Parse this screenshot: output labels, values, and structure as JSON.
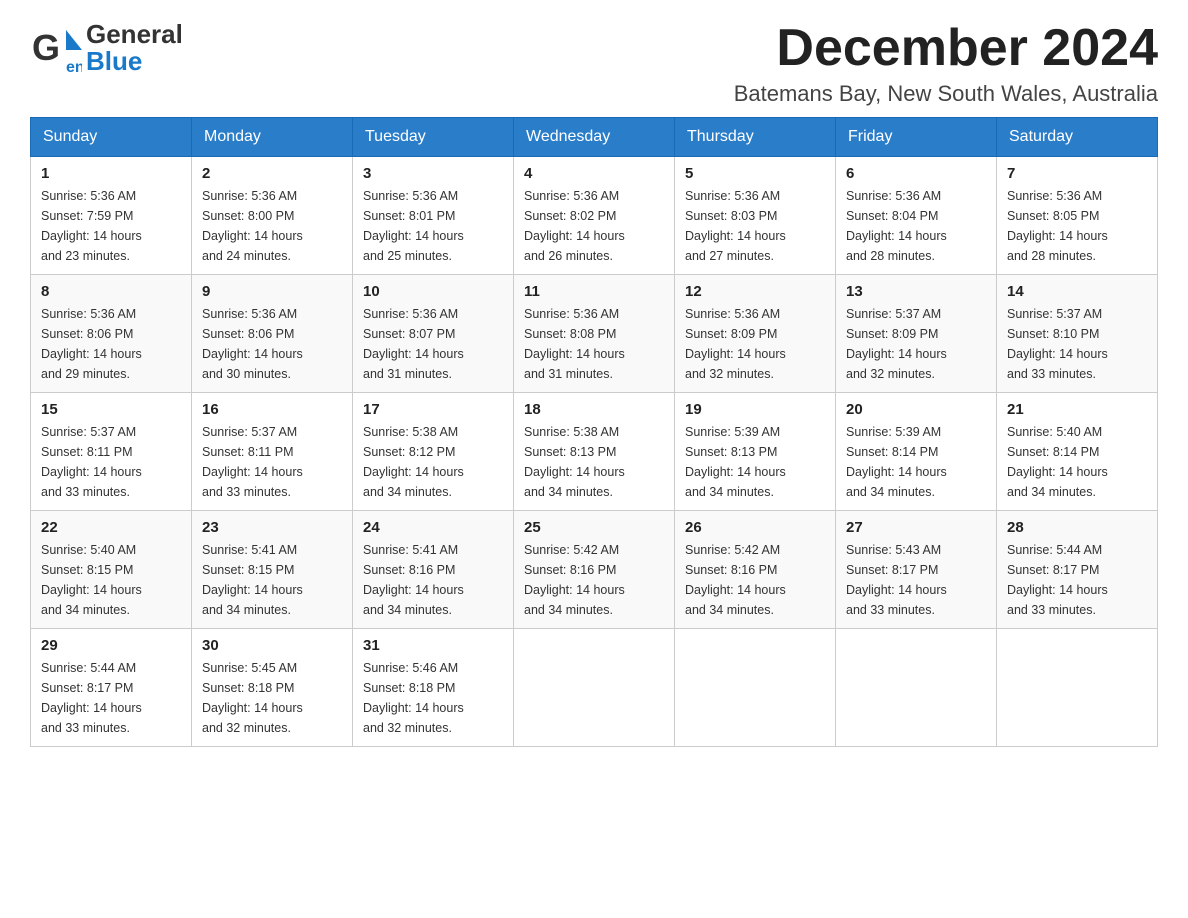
{
  "header": {
    "logo_general": "General",
    "logo_blue": "Blue",
    "month_title": "December 2024",
    "location": "Batemans Bay, New South Wales, Australia"
  },
  "weekdays": [
    "Sunday",
    "Monday",
    "Tuesday",
    "Wednesday",
    "Thursday",
    "Friday",
    "Saturday"
  ],
  "weeks": [
    [
      {
        "day": "1",
        "sunrise": "5:36 AM",
        "sunset": "7:59 PM",
        "daylight": "14 hours and 23 minutes."
      },
      {
        "day": "2",
        "sunrise": "5:36 AM",
        "sunset": "8:00 PM",
        "daylight": "14 hours and 24 minutes."
      },
      {
        "day": "3",
        "sunrise": "5:36 AM",
        "sunset": "8:01 PM",
        "daylight": "14 hours and 25 minutes."
      },
      {
        "day": "4",
        "sunrise": "5:36 AM",
        "sunset": "8:02 PM",
        "daylight": "14 hours and 26 minutes."
      },
      {
        "day": "5",
        "sunrise": "5:36 AM",
        "sunset": "8:03 PM",
        "daylight": "14 hours and 27 minutes."
      },
      {
        "day": "6",
        "sunrise": "5:36 AM",
        "sunset": "8:04 PM",
        "daylight": "14 hours and 28 minutes."
      },
      {
        "day": "7",
        "sunrise": "5:36 AM",
        "sunset": "8:05 PM",
        "daylight": "14 hours and 28 minutes."
      }
    ],
    [
      {
        "day": "8",
        "sunrise": "5:36 AM",
        "sunset": "8:06 PM",
        "daylight": "14 hours and 29 minutes."
      },
      {
        "day": "9",
        "sunrise": "5:36 AM",
        "sunset": "8:06 PM",
        "daylight": "14 hours and 30 minutes."
      },
      {
        "day": "10",
        "sunrise": "5:36 AM",
        "sunset": "8:07 PM",
        "daylight": "14 hours and 31 minutes."
      },
      {
        "day": "11",
        "sunrise": "5:36 AM",
        "sunset": "8:08 PM",
        "daylight": "14 hours and 31 minutes."
      },
      {
        "day": "12",
        "sunrise": "5:36 AM",
        "sunset": "8:09 PM",
        "daylight": "14 hours and 32 minutes."
      },
      {
        "day": "13",
        "sunrise": "5:37 AM",
        "sunset": "8:09 PM",
        "daylight": "14 hours and 32 minutes."
      },
      {
        "day": "14",
        "sunrise": "5:37 AM",
        "sunset": "8:10 PM",
        "daylight": "14 hours and 33 minutes."
      }
    ],
    [
      {
        "day": "15",
        "sunrise": "5:37 AM",
        "sunset": "8:11 PM",
        "daylight": "14 hours and 33 minutes."
      },
      {
        "day": "16",
        "sunrise": "5:37 AM",
        "sunset": "8:11 PM",
        "daylight": "14 hours and 33 minutes."
      },
      {
        "day": "17",
        "sunrise": "5:38 AM",
        "sunset": "8:12 PM",
        "daylight": "14 hours and 34 minutes."
      },
      {
        "day": "18",
        "sunrise": "5:38 AM",
        "sunset": "8:13 PM",
        "daylight": "14 hours and 34 minutes."
      },
      {
        "day": "19",
        "sunrise": "5:39 AM",
        "sunset": "8:13 PM",
        "daylight": "14 hours and 34 minutes."
      },
      {
        "day": "20",
        "sunrise": "5:39 AM",
        "sunset": "8:14 PM",
        "daylight": "14 hours and 34 minutes."
      },
      {
        "day": "21",
        "sunrise": "5:40 AM",
        "sunset": "8:14 PM",
        "daylight": "14 hours and 34 minutes."
      }
    ],
    [
      {
        "day": "22",
        "sunrise": "5:40 AM",
        "sunset": "8:15 PM",
        "daylight": "14 hours and 34 minutes."
      },
      {
        "day": "23",
        "sunrise": "5:41 AM",
        "sunset": "8:15 PM",
        "daylight": "14 hours and 34 minutes."
      },
      {
        "day": "24",
        "sunrise": "5:41 AM",
        "sunset": "8:16 PM",
        "daylight": "14 hours and 34 minutes."
      },
      {
        "day": "25",
        "sunrise": "5:42 AM",
        "sunset": "8:16 PM",
        "daylight": "14 hours and 34 minutes."
      },
      {
        "day": "26",
        "sunrise": "5:42 AM",
        "sunset": "8:16 PM",
        "daylight": "14 hours and 34 minutes."
      },
      {
        "day": "27",
        "sunrise": "5:43 AM",
        "sunset": "8:17 PM",
        "daylight": "14 hours and 33 minutes."
      },
      {
        "day": "28",
        "sunrise": "5:44 AM",
        "sunset": "8:17 PM",
        "daylight": "14 hours and 33 minutes."
      }
    ],
    [
      {
        "day": "29",
        "sunrise": "5:44 AM",
        "sunset": "8:17 PM",
        "daylight": "14 hours and 33 minutes."
      },
      {
        "day": "30",
        "sunrise": "5:45 AM",
        "sunset": "8:18 PM",
        "daylight": "14 hours and 32 minutes."
      },
      {
        "day": "31",
        "sunrise": "5:46 AM",
        "sunset": "8:18 PM",
        "daylight": "14 hours and 32 minutes."
      },
      null,
      null,
      null,
      null
    ]
  ],
  "labels": {
    "sunrise": "Sunrise: ",
    "sunset": "Sunset: ",
    "daylight": "Daylight: "
  }
}
